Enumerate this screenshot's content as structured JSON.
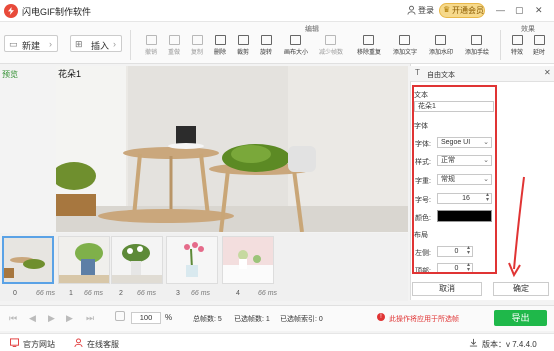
{
  "app": {
    "title": "闪电GIF制作软件"
  },
  "titlebar": {
    "login": "登录",
    "vip": "开通会员",
    "minimize": "—",
    "restore": "▢",
    "close": "✕"
  },
  "toolbar": {
    "new": "新建",
    "insert": "插入",
    "group_edit": "编辑",
    "group_effect": "效果",
    "tools": [
      "撤销",
      "重做",
      "复制",
      "删除",
      "裁剪",
      "旋转",
      "画布大小",
      "减少帧数",
      "移除重复",
      "添加文字",
      "添加水印",
      "添加手绘",
      "特效",
      "延时"
    ]
  },
  "preview": {
    "label": "预览",
    "overlay_text": "花朵1"
  },
  "panel": {
    "title": "自由文本",
    "text_section": "文本",
    "text_value": "花朵1",
    "font_section": "字体",
    "font_label": "字体:",
    "font_value": "Segoe UI",
    "style_label": "样式:",
    "style_value": "正常",
    "weight_label": "字重:",
    "weight_value": "常规",
    "size_label": "字号:",
    "size_value": "16",
    "color_label": "颜色:",
    "color_value": "#000000",
    "layout_section": "布局",
    "left_label": "左侧:",
    "left_value": "0",
    "top_label": "顶部:",
    "top_value": "0",
    "cancel": "取消",
    "ok": "确定"
  },
  "frames": [
    {
      "index": "0",
      "duration": "66 ms"
    },
    {
      "index": "1",
      "duration": "66 ms"
    },
    {
      "index": "2",
      "duration": "66 ms"
    },
    {
      "index": "3",
      "duration": "66 ms"
    },
    {
      "index": "4",
      "duration": "66 ms"
    }
  ],
  "controls": {
    "zoom": "100",
    "zoom_unit": "%",
    "total_frames": "总帧数: 5",
    "selected_frames": "已选帧数: 1",
    "selected_index": "已选帧索引: 0",
    "warning": "此操作将应用于所选帧",
    "export": "导出"
  },
  "footer": {
    "website": "官方网站",
    "support": "在线客服",
    "version": "版本：v 7.4.4.0"
  },
  "colors": {
    "accent_green": "#1fb84a",
    "warning_red": "#e03434",
    "selection_blue": "#5aa2e6"
  }
}
